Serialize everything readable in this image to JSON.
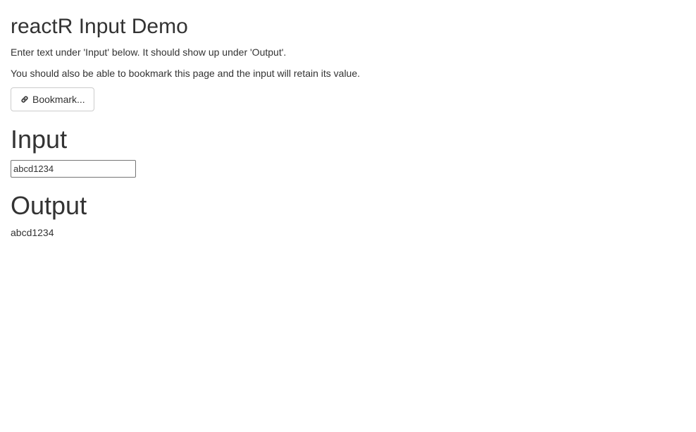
{
  "page": {
    "title": "reactR Input Demo",
    "intro_line_1": "Enter text under 'Input' below. It should show up under 'Output'.",
    "intro_line_2": "You should also be able to bookmark this page and the input will retain its value."
  },
  "bookmark": {
    "label": "Bookmark...",
    "icon": "link-icon"
  },
  "input_section": {
    "heading": "Input",
    "value": "abcd1234"
  },
  "output_section": {
    "heading": "Output",
    "value": "abcd1234"
  }
}
